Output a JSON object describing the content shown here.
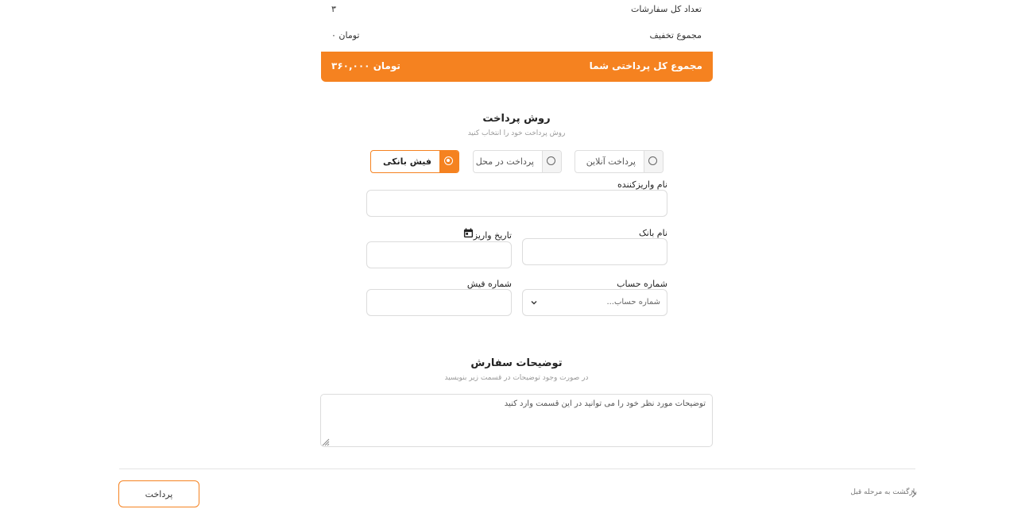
{
  "summary": {
    "orders_count_label": "تعداد کل سفارشات",
    "orders_count_value": "۳",
    "discount_label": "مجموع تخفیف",
    "discount_value": "۰ تومان",
    "total_label": "مجموع کل پرداختی شما",
    "total_value": "۳۶۰,۰۰۰ تومان"
  },
  "payment": {
    "title": "روش پرداخت",
    "subtitle": "روش پرداخت خود را انتخاب کنید",
    "options": [
      {
        "label": "فیش بانکی",
        "selected": true
      },
      {
        "label": "پرداخت در محل",
        "selected": false
      },
      {
        "label": "پرداخت آنلاین",
        "selected": false
      }
    ]
  },
  "form": {
    "depositor_label": "نام واریزکننده",
    "bank_label": "نام بانک",
    "date_label": "تاریخ واریز",
    "account_label": "شماره حساب",
    "account_placeholder": "شماره حساب...",
    "receipt_label": "شماره فیش"
  },
  "notes": {
    "title": "توضیحات سفارش",
    "subtitle": "در صورت وجود توضیحات در قسمت زیر بنویسید",
    "placeholder": "توضیحات مورد نظر خود را می توانید در این قسمت وارد کنید"
  },
  "footer": {
    "pay_button": "پرداخت",
    "back_link": "بازگشت به مرحله قبل"
  },
  "colors": {
    "accent": "#f58220",
    "border": "#dcdcdc"
  }
}
